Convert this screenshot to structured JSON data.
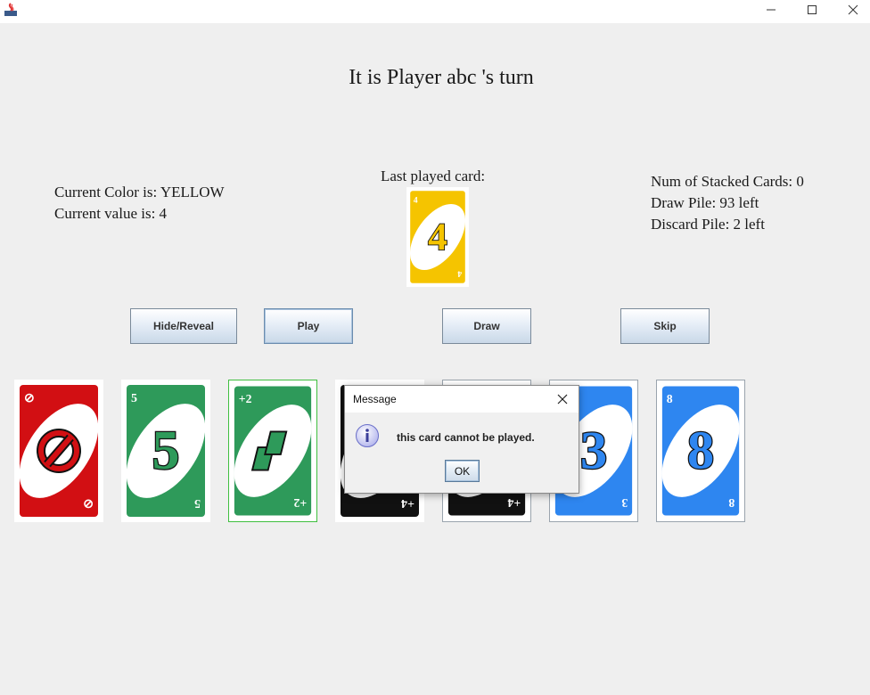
{
  "window": {
    "icon": "java-app-icon",
    "controls": [
      "minimize-icon",
      "maximize-icon",
      "close-icon"
    ]
  },
  "header": {
    "turn_text": "It is Player abc 's turn"
  },
  "status_left": {
    "color_text": "Current Color is: YELLOW",
    "value_text": "Current value is: 4"
  },
  "status_right": {
    "stacked_text": "Num of Stacked Cards: 0",
    "draw_pile_text": "Draw Pile: 93 left",
    "discard_pile_text": "Discard Pile: 2 left"
  },
  "last_played": {
    "label": "Last played card:",
    "card": {
      "color": "#f5c400",
      "value": "4",
      "corner": "4"
    }
  },
  "buttons": {
    "hide_reveal": "Hide/Reveal",
    "play": "Play",
    "draw": "Draw",
    "skip": "Skip"
  },
  "hand": [
    {
      "kind": "skip",
      "color": "#d20f13",
      "corner": "⊘",
      "icon": "skip-icon"
    },
    {
      "kind": "number",
      "color": "#2e9a5a",
      "value": "5",
      "corner": "5"
    },
    {
      "kind": "draw2",
      "color": "#2e9a5a",
      "corner": "+2",
      "icon": "draw-two-icon"
    },
    {
      "kind": "wild4",
      "color": "#111111",
      "corner": "+4"
    },
    {
      "kind": "wild4",
      "color": "#111111",
      "corner": "+4"
    },
    {
      "kind": "number",
      "color": "#2e86f0",
      "value": "3",
      "corner": "3"
    },
    {
      "kind": "number",
      "color": "#2e86f0",
      "value": "8",
      "corner": "8"
    }
  ],
  "dialog": {
    "title": "Message",
    "message": "this card cannot be played.",
    "ok_label": "OK",
    "icon": "info-icon"
  },
  "colors": {
    "yellow": "#f5c400",
    "red": "#d20f13",
    "green": "#2e9a5a",
    "blue": "#2e86f0",
    "black": "#111111"
  }
}
